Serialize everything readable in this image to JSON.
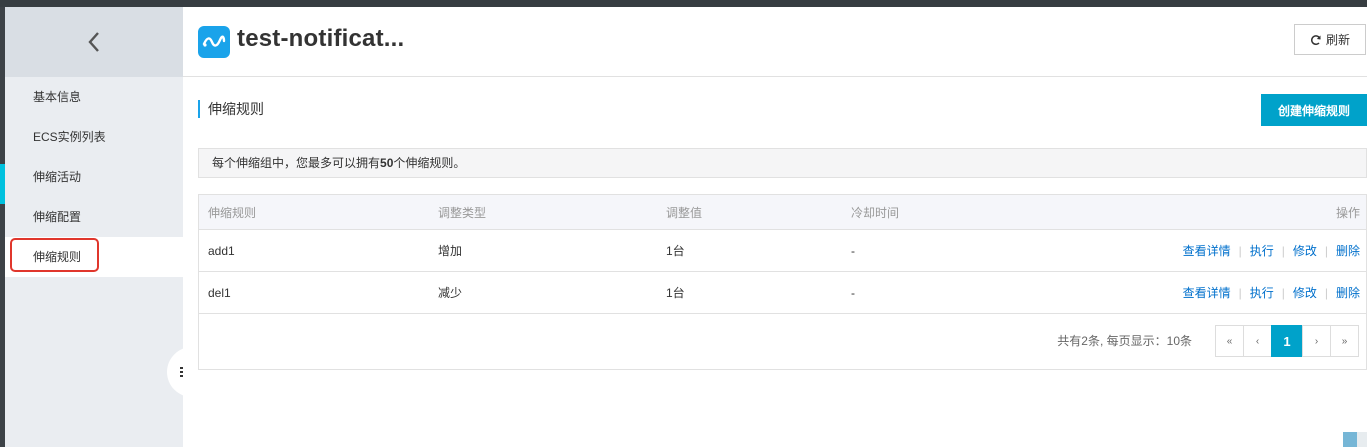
{
  "sidebar": {
    "items": [
      {
        "label": "基本信息"
      },
      {
        "label": "ECS实例列表"
      },
      {
        "label": "伸缩活动"
      },
      {
        "label": "伸缩配置"
      },
      {
        "label": "伸缩规则"
      }
    ],
    "active_index": 4
  },
  "header": {
    "title": "test-notificat...",
    "refresh_label": "刷新"
  },
  "section": {
    "title": "伸缩规则",
    "create_label": "创建伸缩规则"
  },
  "notice": {
    "prefix": "每个伸缩组中，您最多可以拥有",
    "count": "50",
    "suffix": "个伸缩规则。"
  },
  "table": {
    "columns": [
      "伸缩规则",
      "调整类型",
      "调整值",
      "冷却时间",
      "操作"
    ],
    "rows": [
      {
        "name": "add1",
        "type": "增加",
        "value": "1台",
        "cooldown": "-"
      },
      {
        "name": "del1",
        "type": "减少",
        "value": "1台",
        "cooldown": "-"
      }
    ],
    "actions": [
      "查看详情",
      "执行",
      "修改",
      "删除"
    ]
  },
  "pagination": {
    "info": "共有2条, 每页显示：10条",
    "first": "«",
    "prev": "‹",
    "current": "1",
    "next": "›",
    "last": "»"
  },
  "colors": {
    "accent": "#00a2ca",
    "link": "#0070cc",
    "highlight_box": "#e0362c",
    "sidebar_bg": "#eaedf1"
  },
  "icons": {
    "back": "chevron-left-icon",
    "refresh": "refresh-icon",
    "collapse": "menu-icon",
    "logo": "wave-logo-icon"
  }
}
